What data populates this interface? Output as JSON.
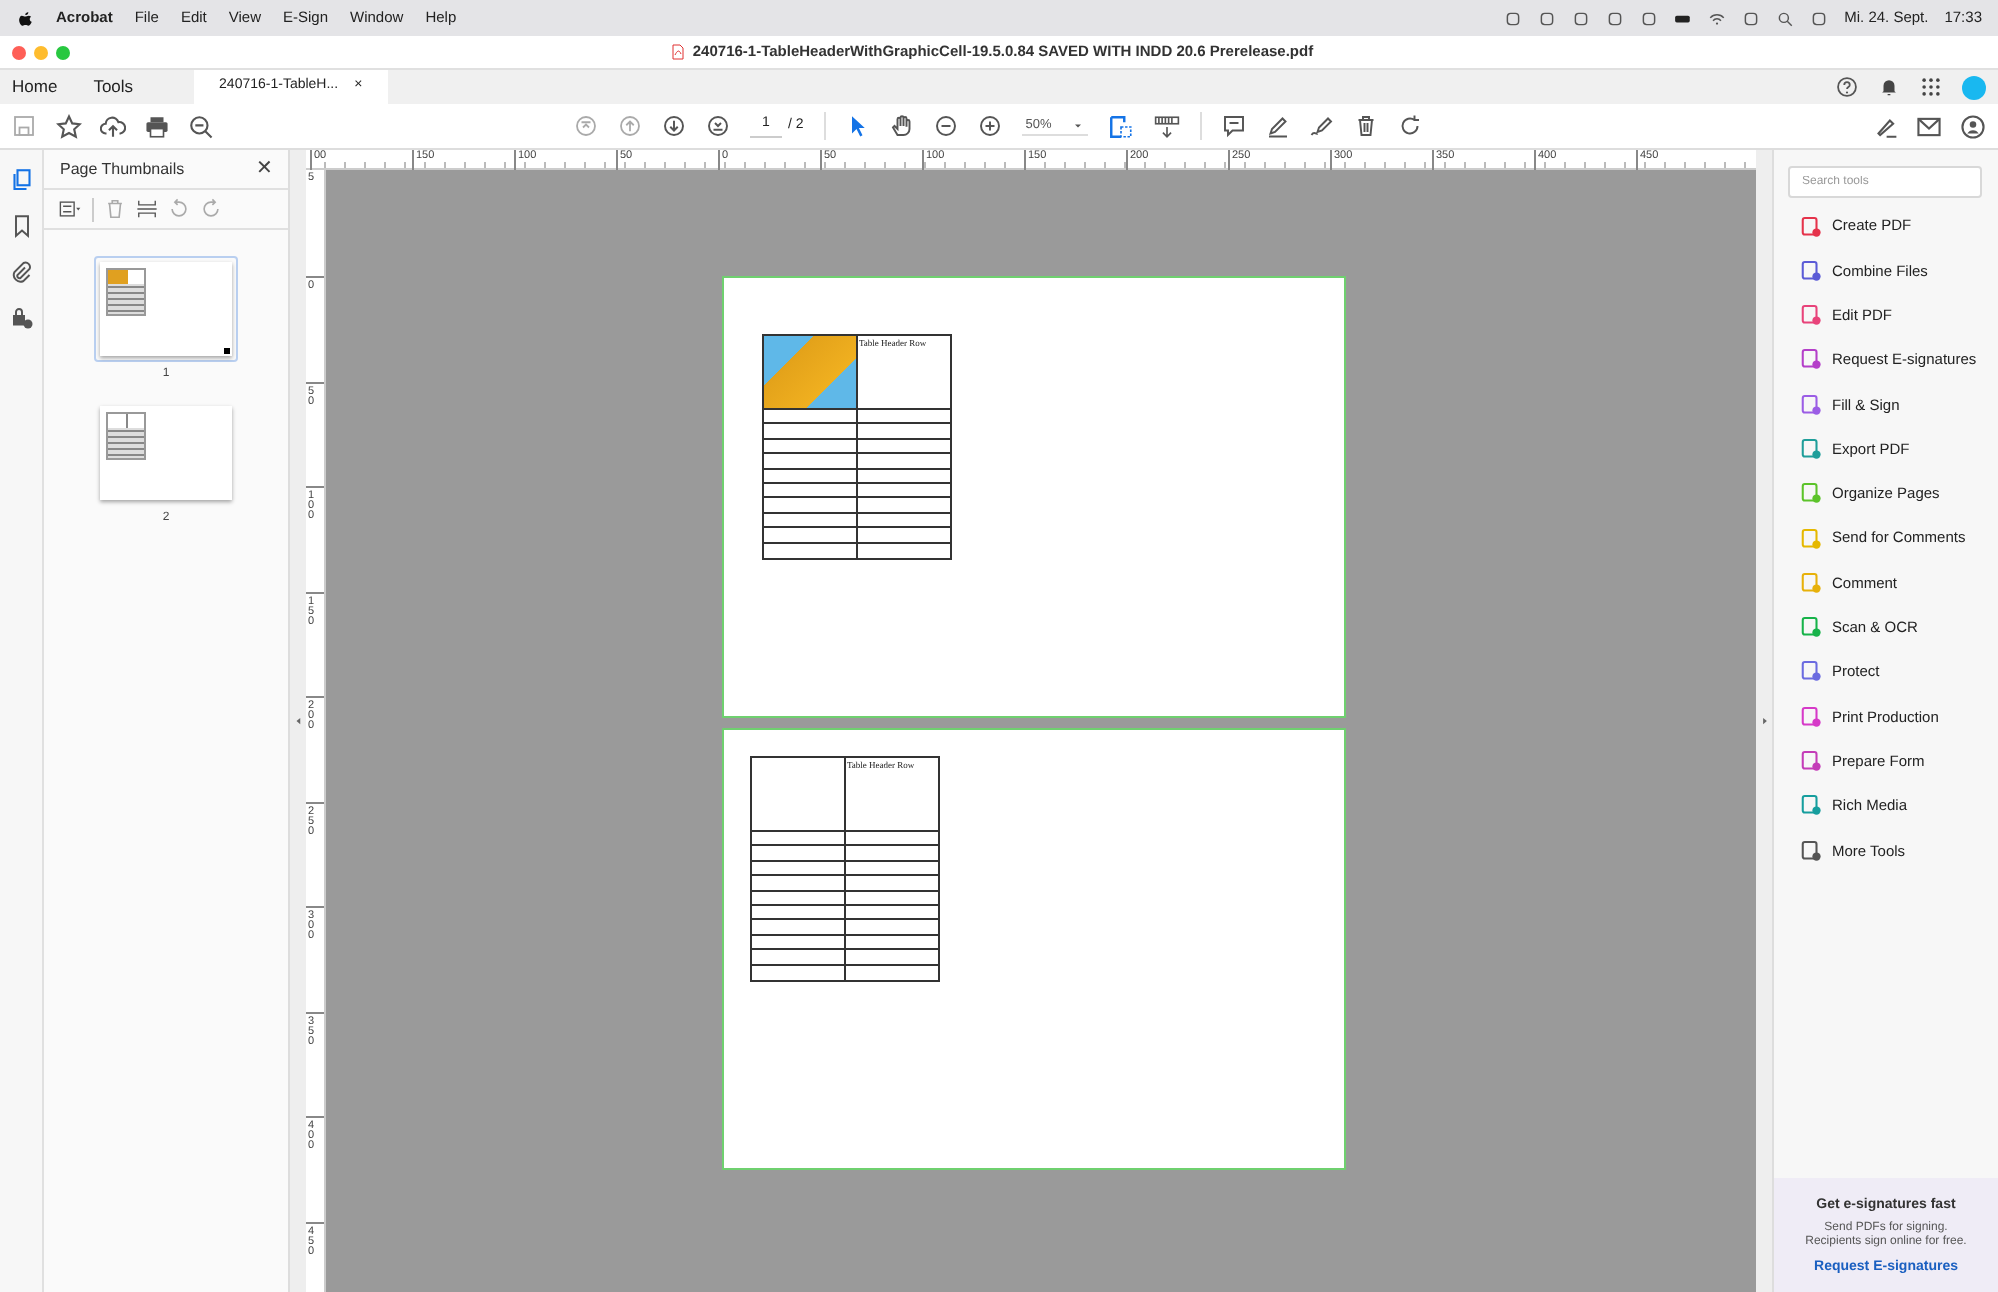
{
  "menu_bar": {
    "app": "Acrobat",
    "items": [
      "File",
      "Edit",
      "View",
      "E-Sign",
      "Window",
      "Help"
    ],
    "date": "Mi. 24. Sept.",
    "time": "17:33"
  },
  "window": {
    "title": "240716-1-TableHeaderWithGraphicCell-19.5.0.84 SAVED WITH INDD 20.6 Prerelease.pdf"
  },
  "nav_tabs": [
    {
      "label": "Home",
      "selected": false,
      "kind": "nav"
    },
    {
      "label": "Tools",
      "selected": false,
      "kind": "nav"
    },
    {
      "label": "240716-1-TableH...",
      "selected": true,
      "kind": "document",
      "close": "×"
    }
  ],
  "toolbar": {
    "page_number": "1",
    "page_total": "/ 2",
    "zoom": "50%"
  },
  "thumbnails_panel": {
    "title": "Page Thumbnails",
    "close": "✕",
    "pages": [
      {
        "label": "1",
        "selected": true,
        "kind": "photo"
      },
      {
        "label": "2",
        "selected": false,
        "kind": "plain"
      }
    ]
  },
  "rulers": {
    "horizontal": [
      "00",
      "150",
      "100",
      "50",
      "0",
      "50",
      "100",
      "150",
      "200",
      "250",
      "300",
      "350",
      "400",
      "450"
    ],
    "vertical": [
      "5",
      "0",
      "50",
      "100",
      "150",
      "200",
      "250",
      "300",
      "350",
      "400",
      "450"
    ]
  },
  "pages": [
    {
      "kind": "photo",
      "header_text": "Table Header Row"
    },
    {
      "kind": "plain",
      "header_text": "Table Header Row"
    }
  ],
  "tools_panel": {
    "search_placeholder": "Search tools",
    "tools": [
      {
        "label": "Create PDF",
        "color": "#e5334b"
      },
      {
        "label": "Combine Files",
        "color": "#5b5bd6"
      },
      {
        "label": "Edit PDF",
        "color": "#e8437a"
      },
      {
        "label": "Request E-signatures",
        "color": "#b43fc9"
      },
      {
        "label": "Fill & Sign",
        "color": "#9b5de5"
      },
      {
        "label": "Export PDF",
        "color": "#1f9e9a"
      },
      {
        "label": "Organize Pages",
        "color": "#5cc32a"
      },
      {
        "label": "Send for Comments",
        "color": "#e5b800"
      },
      {
        "label": "Comment",
        "color": "#e7b10a"
      },
      {
        "label": "Scan & OCR",
        "color": "#17b34a"
      },
      {
        "label": "Protect",
        "color": "#6b6be0"
      },
      {
        "label": "Print Production",
        "color": "#d63ac8"
      },
      {
        "label": "Prepare Form",
        "color": "#c43cb8"
      },
      {
        "label": "Rich Media",
        "color": "#169e9e"
      },
      {
        "label": "More Tools",
        "color": "#555555"
      }
    ]
  },
  "promo": {
    "title": "Get e-signatures fast",
    "text": "Send PDFs for signing. Recipients sign online for free.",
    "link": "Request E-signatures"
  }
}
